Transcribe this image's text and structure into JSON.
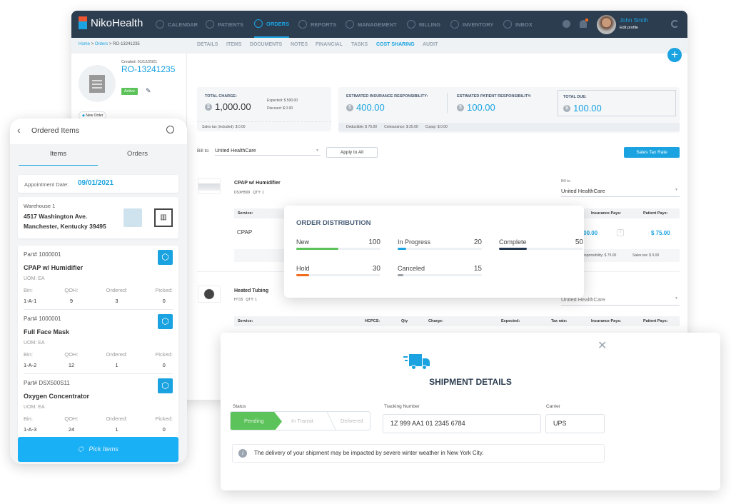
{
  "app": {
    "brand": "NikoHealth",
    "nav": [
      {
        "label": "CALENDAR",
        "icon": "calendar-icon"
      },
      {
        "label": "PATIENTS",
        "icon": "patients-icon"
      },
      {
        "label": "ORDERS",
        "icon": "orders-icon",
        "active": true
      },
      {
        "label": "REPORTS",
        "icon": "reports-icon"
      },
      {
        "label": "MANAGEMENT",
        "icon": "management-icon"
      },
      {
        "label": "BILLING",
        "icon": "billing-icon"
      },
      {
        "label": "INVENTORY",
        "icon": "inventory-icon"
      },
      {
        "label": "INBOX",
        "icon": "inbox-icon"
      }
    ],
    "user": {
      "name": "John Smith",
      "edit": "Edit profile"
    },
    "breadcrumb": {
      "home": "Home",
      "orders": "Orders",
      "current": "RO-13241235",
      "sep": ">"
    },
    "subtabs": [
      "DETAILS",
      "ITEMS",
      "DOCUMENTS",
      "NOTES",
      "FINANCIAL",
      "TASKS",
      "COST SHARING",
      "AUDIT"
    ],
    "active_subtab": "COST SHARING",
    "add": "+"
  },
  "order": {
    "created": "Created: 01/12/2021",
    "id": "RO-13241235",
    "status": "Active",
    "tag": "New Order"
  },
  "summary": {
    "total_charge_label": "TOTAL CHARGE:",
    "total_charge": "1,000.00",
    "expected": "Expected: $ 500.00",
    "discount": "Discount: $ 0.00",
    "sales_tax": "Sales tax (included): $ 0.00",
    "ins_label": "ESTIMATED INSURANCE RESPONSIBILITY:",
    "ins": "400.00",
    "pat_label": "ESTIMATED PATIENT RESPONSIBILITY:",
    "pat": "100.00",
    "due_label": "TOTAL DUE:",
    "due": "100.00",
    "deductible": "Deductible: $ 75.00",
    "coinsurance": "Coinsurance: $ 25.00",
    "copay": "Copay: $ 0.00",
    "currency": "$"
  },
  "billto": {
    "label": "Bill to:",
    "value": "United HealthCare",
    "apply": "Apply to All",
    "sales_tax_btn": "Sales Tax Rate"
  },
  "items": [
    {
      "name": "CPAP w/ Humidifier",
      "code": "DSXH500",
      "qty": "QTY: 1",
      "billto_label": "Bill to:",
      "billto": "United HealthCare",
      "service_header": "Service:",
      "service": "CPAP",
      "ins_header": "Insurance Pays:",
      "pat_header": "Patient Pays:",
      "ins_pays": "$ 400.00",
      "pat_pays": "$ 75.00",
      "footer_resp": "Patient responsibility: $ 75.00",
      "footer_tax": "Sales tax: $ 0.00"
    },
    {
      "name": "Heated Tubing",
      "code": "HT15",
      "qty": "QTY: 1",
      "billto": "United HealthCare",
      "headers": [
        "Service:",
        "HCPCS:",
        "Qty",
        "Charge:",
        "Expected:",
        "Tax rate:",
        "Insurance Pays:",
        "Patient Pays:"
      ]
    }
  ],
  "distribution": {
    "title": "ORDER DISTRIBUTION",
    "items": [
      {
        "label": "New",
        "value": "100",
        "fill": 0.5,
        "color": "#5cc35a"
      },
      {
        "label": "In Progress",
        "value": "20",
        "fill": 0.1,
        "color": "#1aa3e0"
      },
      {
        "label": "Complete",
        "value": "50",
        "fill": 0.33,
        "color": "#22364f"
      },
      {
        "label": "Hold",
        "value": "30",
        "fill": 0.15,
        "color": "#f26b1d"
      },
      {
        "label": "Canceled",
        "value": "15",
        "fill": 0.07,
        "color": "#9aa0a6"
      }
    ]
  },
  "mobile": {
    "title": "Ordered Items",
    "tabs": [
      "Items",
      "Orders"
    ],
    "appt_label": "Appointment Date:",
    "appt": "09/01/2021",
    "warehouse": "Warehouse 1",
    "address1": "4517 Washington Ave.",
    "address2": "Manchester, Kentucky 39495",
    "col_labels": [
      "Bin:",
      "QOH:",
      "Ordered:",
      "Picked:"
    ],
    "parts": [
      {
        "part": "Part# 1000001",
        "name": "CPAP w/ Humidifier",
        "uom": "UOM: EA",
        "bin": "1-A-1",
        "qoh": "9",
        "ordered": "3",
        "picked": "0"
      },
      {
        "part": "Part# 1000001",
        "name": "Full Face Mask",
        "uom": "UOM: EA",
        "bin": "1-A-2",
        "qoh": "12",
        "ordered": "1",
        "picked": "0"
      },
      {
        "part": "Part# DSX500S11",
        "name": "Oxygen Concentrator",
        "uom": "UOM: EA",
        "bin": "1-A-3",
        "qoh": "24",
        "ordered": "1",
        "picked": "0"
      }
    ],
    "pick": "Pick Items"
  },
  "shipment": {
    "title": "SHIPMENT DETAILS",
    "status_label": "Status",
    "steps": [
      "Pending",
      "In Transit",
      "Delivered"
    ],
    "active_step": "Pending",
    "tracking_label": "Tracking Number",
    "tracking": "1Z 999 AA1 01 2345 6784",
    "carrier_label": "Carrier",
    "carrier": "UPS",
    "notice": "The delivery of your shipment may be impacted by severe winter weather in New York City."
  },
  "colors": {
    "accent": "#1aa3e0",
    "nav": "#2c3d50",
    "success": "#5cc35a"
  }
}
